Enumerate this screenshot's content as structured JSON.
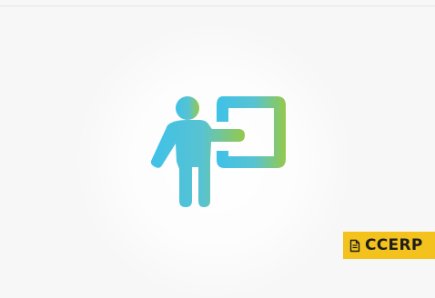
{
  "logo": {
    "icon": "teacher-presentation-icon",
    "gradient_start": "#3fc1e8",
    "gradient_end": "#95c94a"
  },
  "brand": {
    "label": "CCERP",
    "icon": "document-icon",
    "background": "#f3c21d",
    "text_color": "#1d1d1d"
  },
  "page": {
    "background": "#f7f7f7"
  }
}
